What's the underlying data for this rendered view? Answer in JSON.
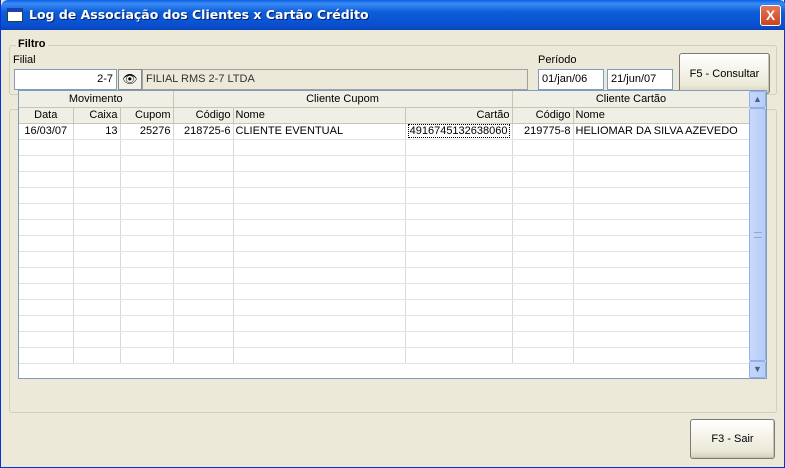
{
  "window": {
    "title": "Log de Associação dos Clientes x Cartão Crédito",
    "close_label": "X"
  },
  "filter": {
    "group_label": "Filtro",
    "filial_label": "Filial",
    "filial_code": "2-7",
    "filial_name": "FILIAL RMS 2-7 LTDA",
    "lookup_icon": "binoculars-icon",
    "periodo_label": "Período",
    "date_from": "01/jan/06",
    "date_to": "21/jun/07",
    "consult_button": "F5 - Consultar"
  },
  "grid": {
    "groups": [
      "Movimento",
      "Cliente Cupom",
      "Cliente Cartão"
    ],
    "columns": [
      "Data",
      "Caixa",
      "Cupom",
      "Código",
      "Nome",
      "Cartão",
      "Código",
      "Nome"
    ],
    "rows": [
      [
        "16/03/07",
        "13",
        "25276",
        "218725-6",
        "CLIENTE EVENTUAL",
        "4916745132638060",
        "219775-8",
        "HELIOMAR DA SILVA AZEVEDO"
      ]
    ],
    "empty_rows": 14
  },
  "footer": {
    "exit_button": "F3 - Sair"
  }
}
